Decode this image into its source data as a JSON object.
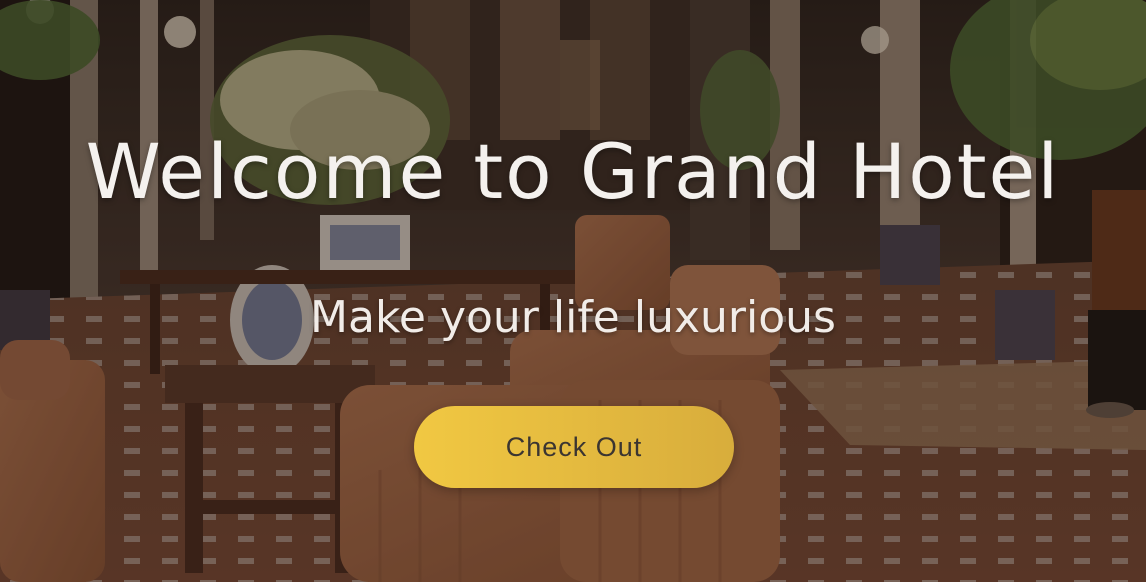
{
  "hero": {
    "title": "Welcome to Grand Hotel",
    "subtitle": "Make your life luxurious",
    "cta_label": "Check Out"
  },
  "colors": {
    "cta_start": "#f1c842",
    "cta_end": "#d8ad3c",
    "cta_text": "#3b3531",
    "heading_text": "#f4f1ee"
  }
}
